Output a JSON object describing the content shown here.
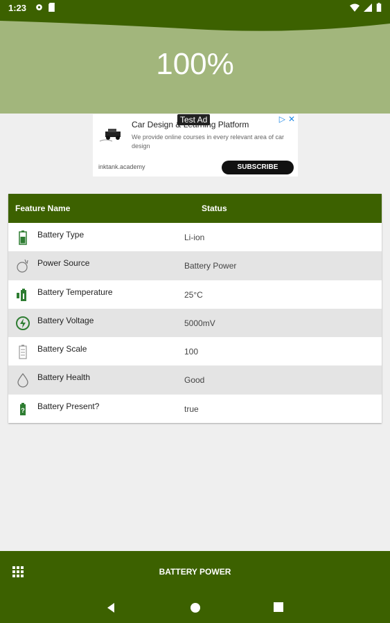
{
  "status_bar": {
    "time": "1:23"
  },
  "header": {
    "percent": "100%"
  },
  "ad": {
    "badge": "Test Ad",
    "title": "Car Design & Learning Platform",
    "description": "We provide online courses in every relevant area of car design",
    "domain": "inktank.academy",
    "cta": "SUBSCRIBE"
  },
  "table": {
    "col_feature": "Feature Name",
    "col_status": "Status",
    "rows": [
      {
        "name": "Battery Type",
        "value": "Li-ion",
        "icon": "battery-icon"
      },
      {
        "name": "Power Source",
        "value": "Battery Power",
        "icon": "power-plug-icon"
      },
      {
        "name": "Battery Temperature",
        "value": "25°C",
        "icon": "thermometer-battery-icon"
      },
      {
        "name": "Battery Voltage",
        "value": "5000mV",
        "icon": "voltage-icon"
      },
      {
        "name": "Battery Scale",
        "value": "100",
        "icon": "battery-scale-icon"
      },
      {
        "name": "Battery Health",
        "value": "Good",
        "icon": "drop-icon"
      },
      {
        "name": "Battery Present?",
        "value": "true",
        "icon": "battery-unknown-icon"
      }
    ]
  },
  "bottom_bar": {
    "title": "BATTERY POWER"
  },
  "colors": {
    "primary": "#3c6100",
    "header": "#a2b67c",
    "background": "#efefef"
  }
}
